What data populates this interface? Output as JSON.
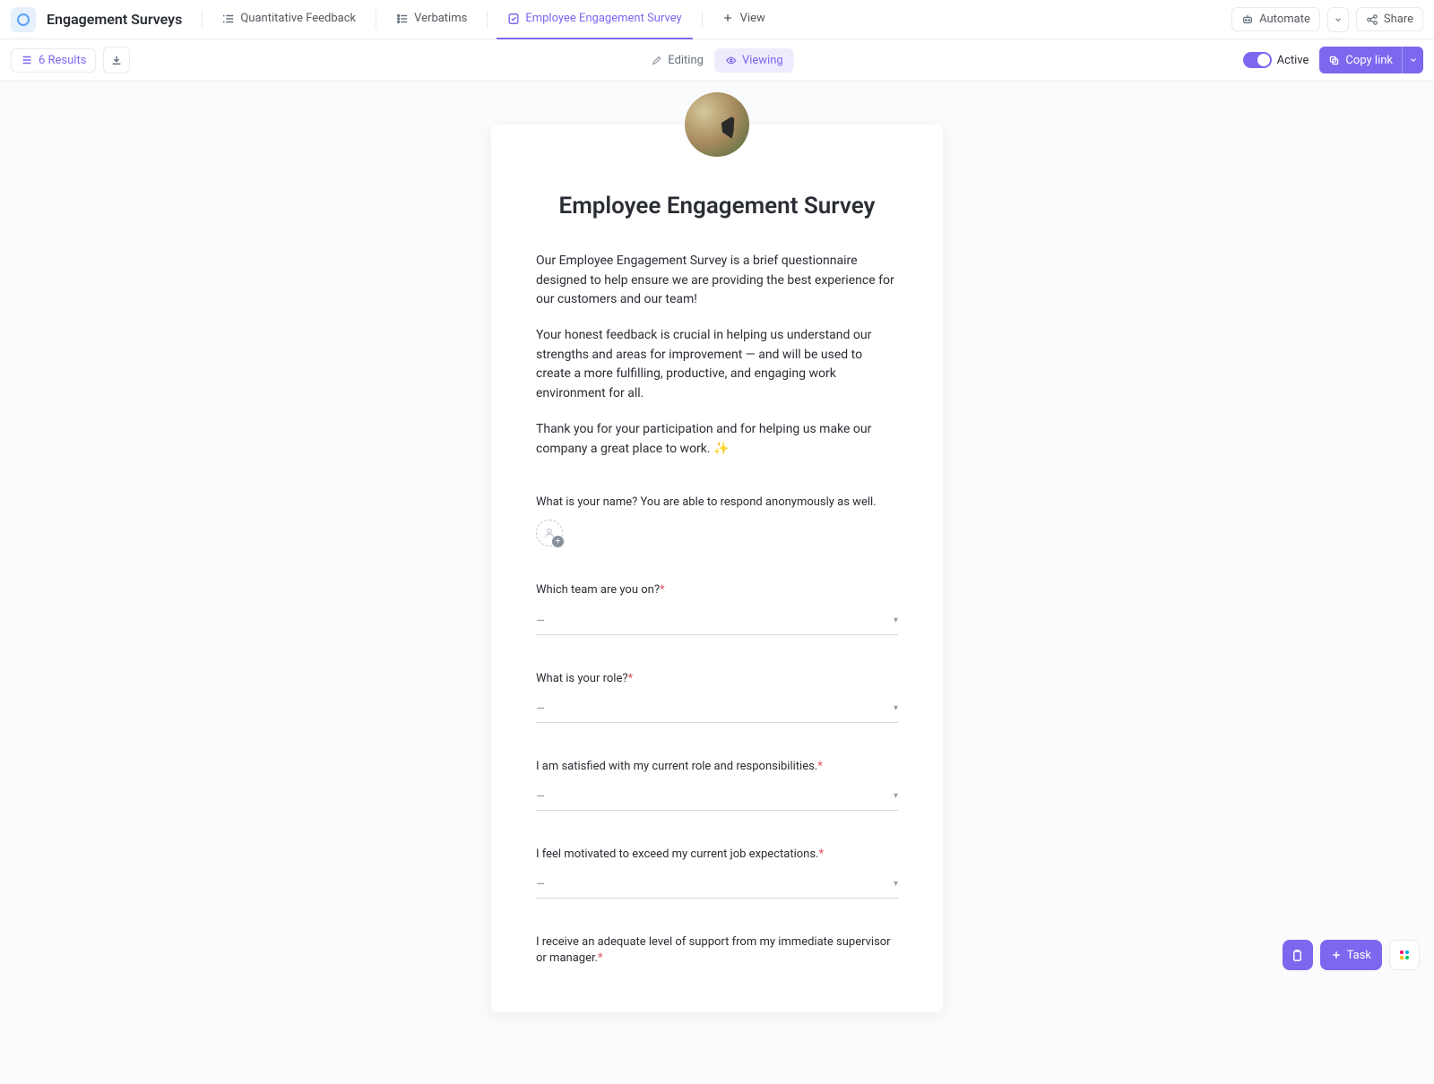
{
  "header": {
    "workspace_title": "Engagement Surveys",
    "tabs": [
      {
        "label": "Quantitative Feedback"
      },
      {
        "label": "Verbatims"
      },
      {
        "label": "Employee Engagement Survey"
      }
    ],
    "add_view_label": "View",
    "automate_label": "Automate",
    "share_label": "Share"
  },
  "subbar": {
    "results_label": "6 Results",
    "editing_label": "Editing",
    "viewing_label": "Viewing",
    "active_label": "Active",
    "copy_link_label": "Copy link"
  },
  "form": {
    "title": "Employee Engagement Survey",
    "para1": "Our Employee Engagement Survey is a brief questionnaire designed to help ensure we are providing the best experience for our customers and our team!",
    "para2": "Your honest feedback is crucial in helping us understand our strengths and areas for improvement — and will be used to create a more fulfilling, productive, and engaging work environment for all.",
    "para3_a": "Thank you for your participation and for helping us make our company a great place to work.  ",
    "para3_sparkle": "✨",
    "questions": {
      "q1": "What is your name? You are able to respond anonymously as well.",
      "q2": "Which team are you on?",
      "q3": "What is your role?",
      "q4": "I am satisfied with my current role and responsibilities.",
      "q5": "I feel motivated to exceed my current job expectations.",
      "q6": "I receive an adequate level of support from my immediate supervisor or manager."
    },
    "required_mark": "*",
    "dropdown_placeholder": "–"
  },
  "floating": {
    "task_label": "Task"
  }
}
